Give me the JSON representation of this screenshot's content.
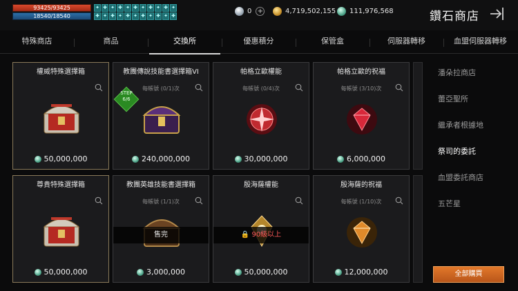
{
  "player": {
    "hp": "93425/93425",
    "mp": "18540/18540"
  },
  "buffs": [
    "✦",
    "✚",
    "✦",
    "✚",
    "✦",
    "✚",
    "✦",
    "✚",
    "✦",
    "✚",
    "✦",
    "✚",
    "✦",
    "✚",
    "✦",
    "✚",
    "✦",
    "✚",
    "✦",
    "✚",
    "✦",
    "✚"
  ],
  "currency": {
    "diamond": "0",
    "gold": "4,719,502,155",
    "gem": "111,976,568"
  },
  "shop_title": "鑽石商店",
  "tabs": [
    "特殊商店",
    "商品",
    "交換所",
    "優惠積分",
    "保管盒",
    "伺服器轉移",
    "血盟伺服器轉移"
  ],
  "active_tab": 2,
  "cards": [
    {
      "title": "權威特殊選擇箱",
      "limit": "",
      "price": "50,000,000"
    },
    {
      "title": "教團傳說技能書選擇箱VI",
      "limit": "每帳號 (0/1)次",
      "price": "240,000,000",
      "step": "STEP\n6/6"
    },
    {
      "title": "帕格立歐權能",
      "limit": "每帳號 (0/4)次",
      "price": "30,000,000"
    },
    {
      "title": "帕格立歐的祝福",
      "limit": "每帳號 (3/10)次",
      "price": "6,000,000"
    },
    {
      "title": "尊貴特殊選擇箱",
      "limit": "",
      "price": "50,000,000"
    },
    {
      "title": "教團英雄技能書選擇箱",
      "limit": "每帳號 (1/1)次",
      "price": "3,000,000",
      "overlay": "售完"
    },
    {
      "title": "殷海薩權能",
      "limit": "",
      "price": "50,000,000",
      "overlay": "90級以上"
    },
    {
      "title": "殷海薩的祝福",
      "limit": "每帳號 (1/10)次",
      "price": "12,000,000"
    }
  ],
  "right_menu": [
    "潘朵拉商店",
    "蕾亞聖所",
    "繼承者根據地",
    "祭司的委託",
    "血盟委託商店",
    "五芒星"
  ],
  "right_menu_active": 3,
  "buy_all": "全部購買",
  "colors": {
    "accent": "#d9772a",
    "lock_red": "#ff5a5a",
    "step_green": "#2a8a22"
  }
}
